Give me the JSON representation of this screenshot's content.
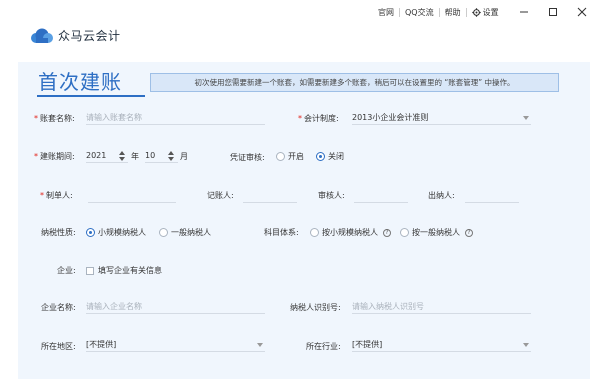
{
  "app": {
    "logo_text": "众马云会计"
  },
  "topnav": {
    "items": [
      "官网",
      "QQ交流",
      "帮助"
    ],
    "settings": "设置"
  },
  "page": {
    "title": "首次建账",
    "notice": "初次使用您需要新建一个账套，如需要新建多个账套，稍后可以在设置里的 “账套管理” 中操作。"
  },
  "form": {
    "account_name": {
      "label": "账套名称:",
      "placeholder": "请输入账套名称"
    },
    "accounting_system": {
      "label": "会计制度:",
      "value": "2013小企业会计准则"
    },
    "period": {
      "label": "建账期间:",
      "year": "2021",
      "year_unit": "年",
      "month": "10",
      "month_unit": "月"
    },
    "voucher_review": {
      "label": "凭证审核:",
      "options": [
        "开启",
        "关闭"
      ],
      "selected": "关闭"
    },
    "preparer": {
      "label": "制单人:"
    },
    "bookkeeper": {
      "label": "记账人:"
    },
    "reviewer": {
      "label": "审核人:"
    },
    "cashier": {
      "label": "出纳人:"
    },
    "taxpayer_type": {
      "label": "纳税性质:",
      "options": [
        "小规模纳税人",
        "一般纳税人"
      ],
      "selected": "小规模纳税人"
    },
    "subject_system": {
      "label": "科目体系:",
      "options": [
        "按小规模纳税人",
        "按一般纳税人"
      ],
      "selected": ""
    },
    "enterprise": {
      "label": "企业:",
      "checkbox_label": "填写企业有关信息"
    },
    "company_name": {
      "label": "企业名称:",
      "placeholder": "请输入企业名称"
    },
    "tax_id": {
      "label": "纳税人识别号:",
      "placeholder": "请输入纳税人识别号"
    },
    "region": {
      "label": "所在地区:",
      "value": "[不提供]"
    },
    "industry": {
      "label": "所在行业:",
      "value": "[不提供]"
    }
  },
  "colors": {
    "accent": "#2e6fc4",
    "required": "#e2231a",
    "panel_bg": "#f0f6fd",
    "notice_bg": "#d9e7f8"
  },
  "icons": {
    "logo": "cloud-logo-icon",
    "settings": "gear-icon",
    "minimize": "minimize-icon",
    "maximize": "maximize-icon",
    "close": "close-icon"
  }
}
